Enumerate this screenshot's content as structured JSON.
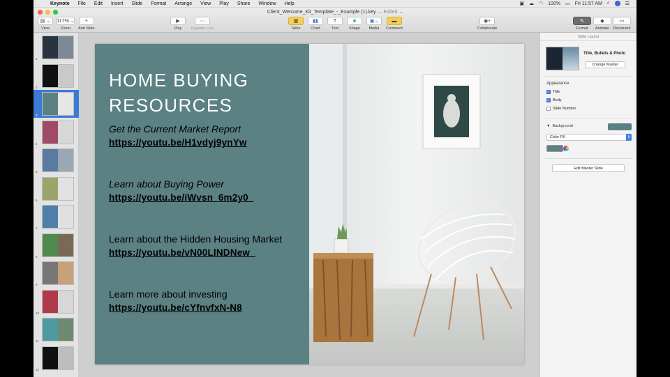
{
  "menubar": {
    "apple": "",
    "app_name": "Keynote",
    "items": [
      "File",
      "Edit",
      "Insert",
      "Slide",
      "Format",
      "Arrange",
      "View",
      "Play",
      "Share",
      "Window",
      "Help"
    ],
    "battery": "100%",
    "clock": "Fri 11:57 AM"
  },
  "window": {
    "title": "Client_Welcome_Kit_Template_-_Example (1).key",
    "status": "— Edited ⌄"
  },
  "toolbar": {
    "view_label": "View",
    "zoom_value": "117%",
    "zoom_label": "Zoom",
    "add_slide_label": "Add Slide",
    "play_label": "Play",
    "keynote_live_label": "Keynote Live",
    "table_label": "Table",
    "chart_label": "Chart",
    "text_label": "Text",
    "shape_label": "Shape",
    "media_label": "Media",
    "comment_label": "Comment",
    "collaborate_label": "Collaborate",
    "format_label": "Format",
    "animate_label": "Animate",
    "document_label": "Document"
  },
  "navigator": {
    "slides": [
      {
        "num": "1",
        "left": "#2a3440",
        "right": "#7d8a96"
      },
      {
        "num": "2",
        "left": "#111111",
        "right": "#c9c9c9"
      },
      {
        "num": "3",
        "left": "#5b8183",
        "right": "#e6e6e6"
      },
      {
        "num": "4",
        "left": "#a04a66",
        "right": "#d8d8d8"
      },
      {
        "num": "5",
        "left": "#5a7aa0",
        "right": "#9aa8b4"
      },
      {
        "num": "6",
        "left": "#9aa56a",
        "right": "#e2e2e2"
      },
      {
        "num": "7",
        "left": "#4f7fa8",
        "right": "#e0e0e0"
      },
      {
        "num": "8",
        "left": "#4f8a4f",
        "right": "#7a6a55"
      },
      {
        "num": "9",
        "left": "#777777",
        "right": "#c8a07a"
      },
      {
        "num": "10",
        "left": "#b03a4a",
        "right": "#d7d7d7"
      },
      {
        "num": "11",
        "left": "#4f9aa0",
        "right": "#6e8a70"
      },
      {
        "num": "12",
        "left": "#111111",
        "right": "#bdbdbd"
      }
    ],
    "selected_index": 2
  },
  "slide": {
    "title_line1": "HOME BUYING",
    "title_line2": "RESOURCES",
    "resources": [
      {
        "heading": "Get the Current Market Report",
        "url": "https://youtu.be/H1vdyj9ynYw",
        "italic": true
      },
      {
        "heading": "Learn about Buying Power",
        "url": "https://youtu.be/iWvsn_6m2y0_",
        "italic": true
      },
      {
        "heading": "Learn about the Hidden Housing Market",
        "url": "https://youtu.be/vN00LlNDNew_",
        "italic": false
      },
      {
        "heading": "Learn more about investing",
        "url": "https://youtu.be/cYfnvfxN-N8",
        "italic": false
      }
    ],
    "colors": {
      "panel": "#5b8183"
    }
  },
  "inspector": {
    "header": "Slide Layout",
    "layout_name": "Title, Bullets & Photo",
    "change_master": "Change Master",
    "appearance": "Appearance",
    "checks": [
      {
        "label": "Title",
        "checked": true
      },
      {
        "label": "Body",
        "checked": true
      },
      {
        "label": "Slide Number",
        "checked": false
      }
    ],
    "background_label": "Background",
    "fill_type": "Color Fill",
    "edit_master": "Edit Master Slide"
  }
}
